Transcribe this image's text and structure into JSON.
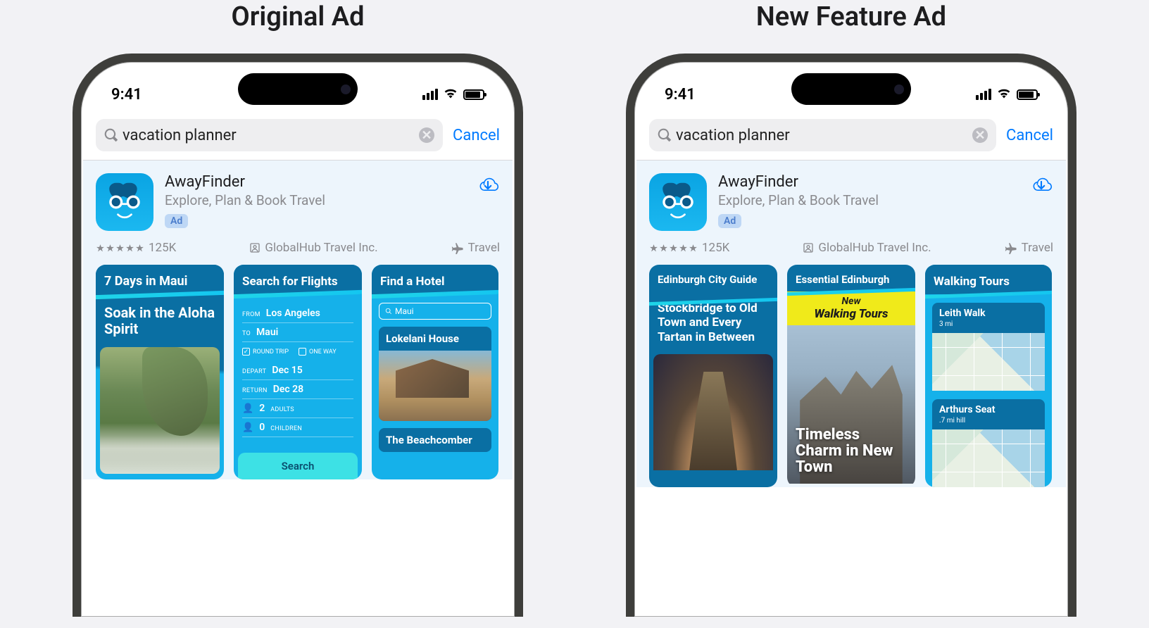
{
  "left_title": "Original Ad",
  "right_title": "New Feature Ad",
  "status": {
    "time": "9:41"
  },
  "search": {
    "query": "vacation planner",
    "cancel": "Cancel"
  },
  "app": {
    "name": "AwayFinder",
    "tagline": "Explore, Plan & Book Travel",
    "ad_badge": "Ad",
    "rating_count": "125K",
    "developer": "GlobalHub Travel Inc.",
    "category": "Travel"
  },
  "original": {
    "card1": {
      "title": "7 Days in Maui",
      "subtitle": "Soak in the Aloha Spirit"
    },
    "card2": {
      "title": "Search for Flights",
      "from_label": "FROM",
      "from": "Los Angeles",
      "to_label": "TO",
      "to": "Maui",
      "round_trip": "ROUND TRIP",
      "one_way": "ONE WAY",
      "depart_label": "DEPART",
      "depart": "Dec 15",
      "return_label": "RETURN",
      "return": "Dec 28",
      "adults_n": "2",
      "adults": "ADULTS",
      "children_n": "0",
      "children": "CHILDREN",
      "search": "Search"
    },
    "card3": {
      "title": "Find a Hotel",
      "search_value": "Maui",
      "h1": "Lokelani House",
      "h2": "The Beachcomber"
    }
  },
  "newad": {
    "card1": {
      "title": "Edinburgh City Guide",
      "subtitle": "Stockbridge to Old Town and Every Tartan in Between"
    },
    "card2": {
      "title": "Essential Edinburgh",
      "banner_new": "New",
      "banner_wt": "Walking Tours",
      "overlay": "Timeless Charm in New Town"
    },
    "card3": {
      "title": "Walking Tours",
      "t1_name": "Leith Walk",
      "t1_dist": "3 mi",
      "t2_name": "Arthurs Seat",
      "t2_dist": ".7 mi hill"
    }
  }
}
